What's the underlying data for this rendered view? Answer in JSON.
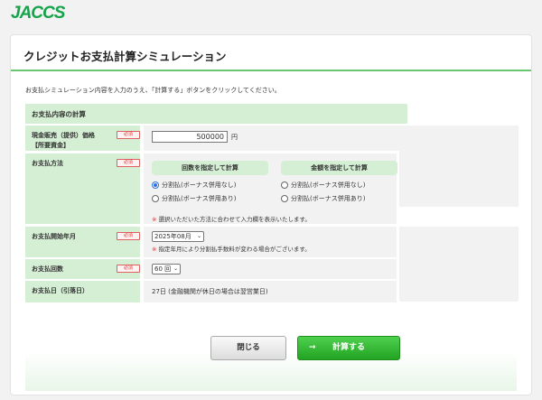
{
  "brand": {
    "logo_text": "JACCS",
    "color": "#16a34a"
  },
  "page": {
    "title": "クレジットお支払計算シミュレーション",
    "intro": "お支払シミュレーション内容を入力のうえ、「計算する」ボタンをクリックしてください。",
    "table_header": "お支払内容の計算",
    "required_label": "必須"
  },
  "fields": {
    "price": {
      "label_line1": "現金販売（提供）価格",
      "label_line2": "【所要資金】",
      "value": "500000",
      "unit": "円"
    },
    "method": {
      "label": "お支払方法",
      "by_count": {
        "title": "回数を指定して計算",
        "options": [
          "分割払(ボーナス併用なし)",
          "分割払(ボーナス併用あり)"
        ],
        "selected": 0
      },
      "by_amount": {
        "title": "金額を指定して計算",
        "options": [
          "分割払(ボーナス併用なし)",
          "分割払(ボーナス併用あり)"
        ]
      },
      "note_mark": "※",
      "note": "選択いただいた方法に合わせて入力欄を表示いたします。"
    },
    "start_month": {
      "label": "お支払開始年月",
      "value": "2025年08月",
      "note_mark": "※",
      "note": "指定年月により分割払手数料が変わる場合がございます。"
    },
    "count": {
      "label": "お支払回数",
      "value": "60 回"
    },
    "pay_day": {
      "label": "お支払日（引落日）",
      "value": "27日 (金融機関が休日の場合は翌営業日)"
    }
  },
  "buttons": {
    "close": "閉じる",
    "calculate": "計算する",
    "calculate_arrow": "→"
  }
}
